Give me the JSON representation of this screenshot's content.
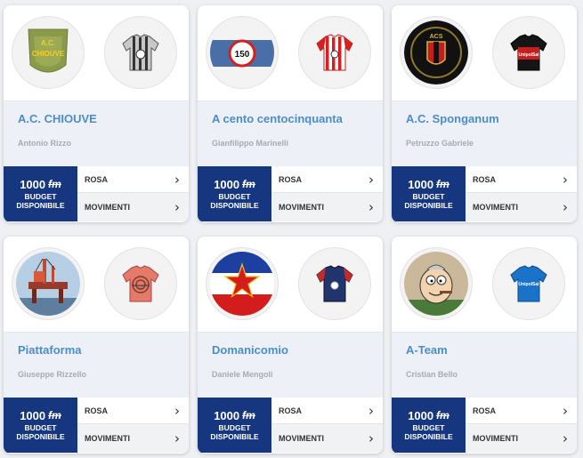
{
  "budget": {
    "amount": "1000",
    "currency": "fm",
    "label": "BUDGET DISPONIBILE"
  },
  "links": {
    "rosa": "ROSA",
    "movimenti": "MOVIMENTI"
  },
  "teams": [
    {
      "name": "A.C. CHIOUVE",
      "manager": "Antonio Rizzo",
      "logo_text": "A.C. CHIOUVE",
      "kit": "grey-black-stripes"
    },
    {
      "name": "A cento centocinquanta",
      "manager": "Gianfilippo Marinelli",
      "logo_text": "150",
      "kit": "red-white-stripes"
    },
    {
      "name": "A.C. Sponganum",
      "manager": "Petruzzo Gabriele",
      "logo_text": "ACS",
      "kit": "black-red",
      "kit_text": "UnipolSai"
    },
    {
      "name": "Piattaforma",
      "manager": "Giuseppe Rizzello",
      "logo_text": "",
      "kit": "orange-pink",
      "kit_text": "Aeroporto"
    },
    {
      "name": "Domanicomio",
      "manager": "Daniele Mengoli",
      "logo_text": "",
      "kit": "navy"
    },
    {
      "name": "A-Team",
      "manager": "Cristian Bello",
      "logo_text": "",
      "kit": "blue",
      "kit_text": "UnipolSai"
    }
  ],
  "colors": {
    "accent": "#4a8ec9",
    "budget_bg": "#16367f"
  }
}
